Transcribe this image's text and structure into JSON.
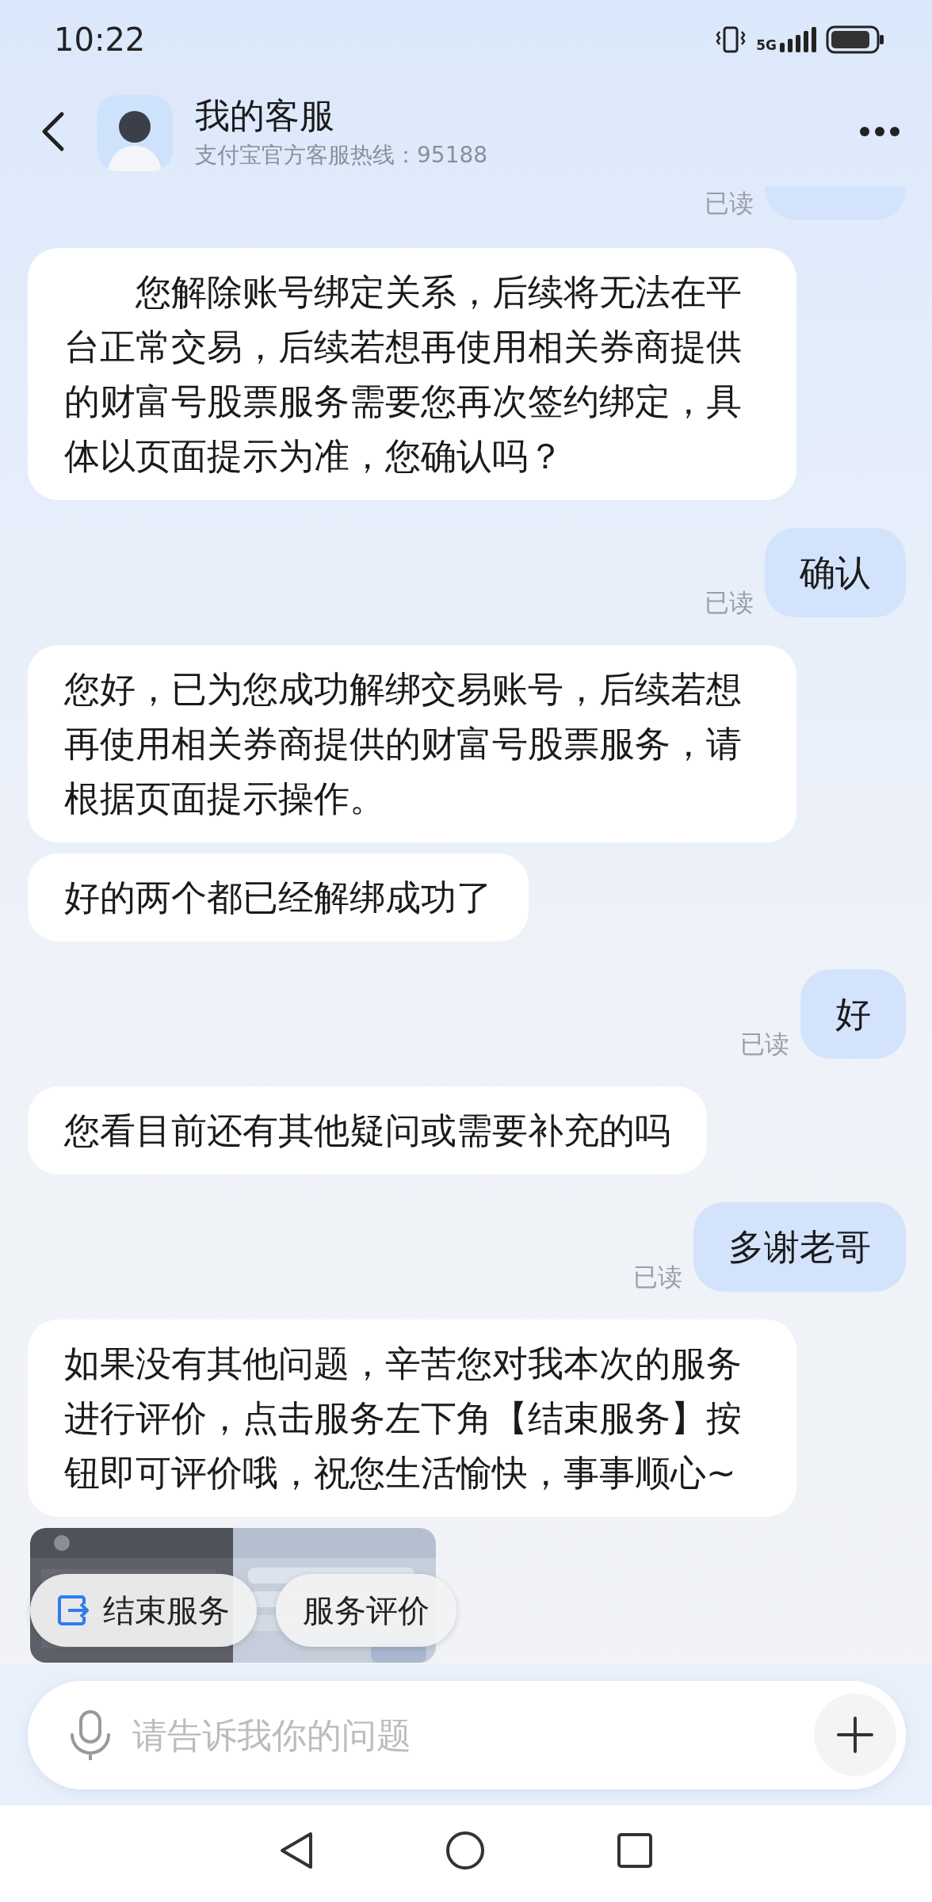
{
  "status_bar": {
    "time": "10:22",
    "network": "5G"
  },
  "header": {
    "title": "我的客服",
    "subtitle": "支付宝官方客服热线：95188"
  },
  "messages": [
    {
      "kind": "outgoing-clipped",
      "read": "已读"
    },
    {
      "kind": "incoming",
      "text": "　　您解除账号绑定关系，后续将无法在平台正常交易，后续若想再使用相关券商提供的财富号股票服务需要您再次签约绑定，具体以页面提示为准，您确认吗？"
    },
    {
      "kind": "outgoing",
      "text": "确认",
      "read": "已读"
    },
    {
      "kind": "incoming",
      "text": "您好，已为您成功解绑交易账号，后续若想再使用相关券商提供的财富号股票服务，请根据页面提示操作。"
    },
    {
      "kind": "incoming",
      "text": "好的两个都已经解绑成功了"
    },
    {
      "kind": "outgoing",
      "text": "好",
      "read": "已读"
    },
    {
      "kind": "incoming",
      "text": "您看目前还有其他疑问或需要补充的吗"
    },
    {
      "kind": "outgoing",
      "text": "多谢老哥",
      "read": "已读"
    },
    {
      "kind": "incoming",
      "text": "如果没有其他问题，辛苦您对我本次的服务进行评价，点击服务左下角【结束服务】按钮即可评价哦，祝您生活愉快，事事顺心~"
    }
  ],
  "quick_actions": [
    {
      "label": "结束服务",
      "kind": "exit"
    },
    {
      "label": "服务评价"
    }
  ],
  "input": {
    "placeholder": "请告诉我你的问题"
  }
}
